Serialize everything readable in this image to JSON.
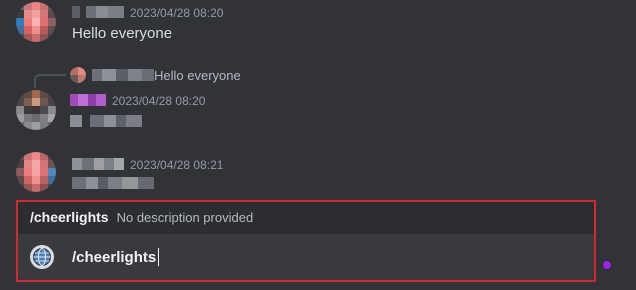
{
  "messages": [
    {
      "timestamp": "2023/04/28 08:20",
      "text": "Hello everyone"
    },
    {
      "reply_preview": "Hello everyone",
      "timestamp": "2023/04/28 08:20"
    },
    {
      "timestamp": "2023/04/28 08:21"
    }
  ],
  "command_popup": {
    "name": "/cheerlights",
    "description": "No description provided"
  },
  "input": {
    "value": "/cheerlights"
  },
  "colors": {
    "background": "#313338",
    "highlight": "#d7262e",
    "status_dot": "#a020f0"
  }
}
